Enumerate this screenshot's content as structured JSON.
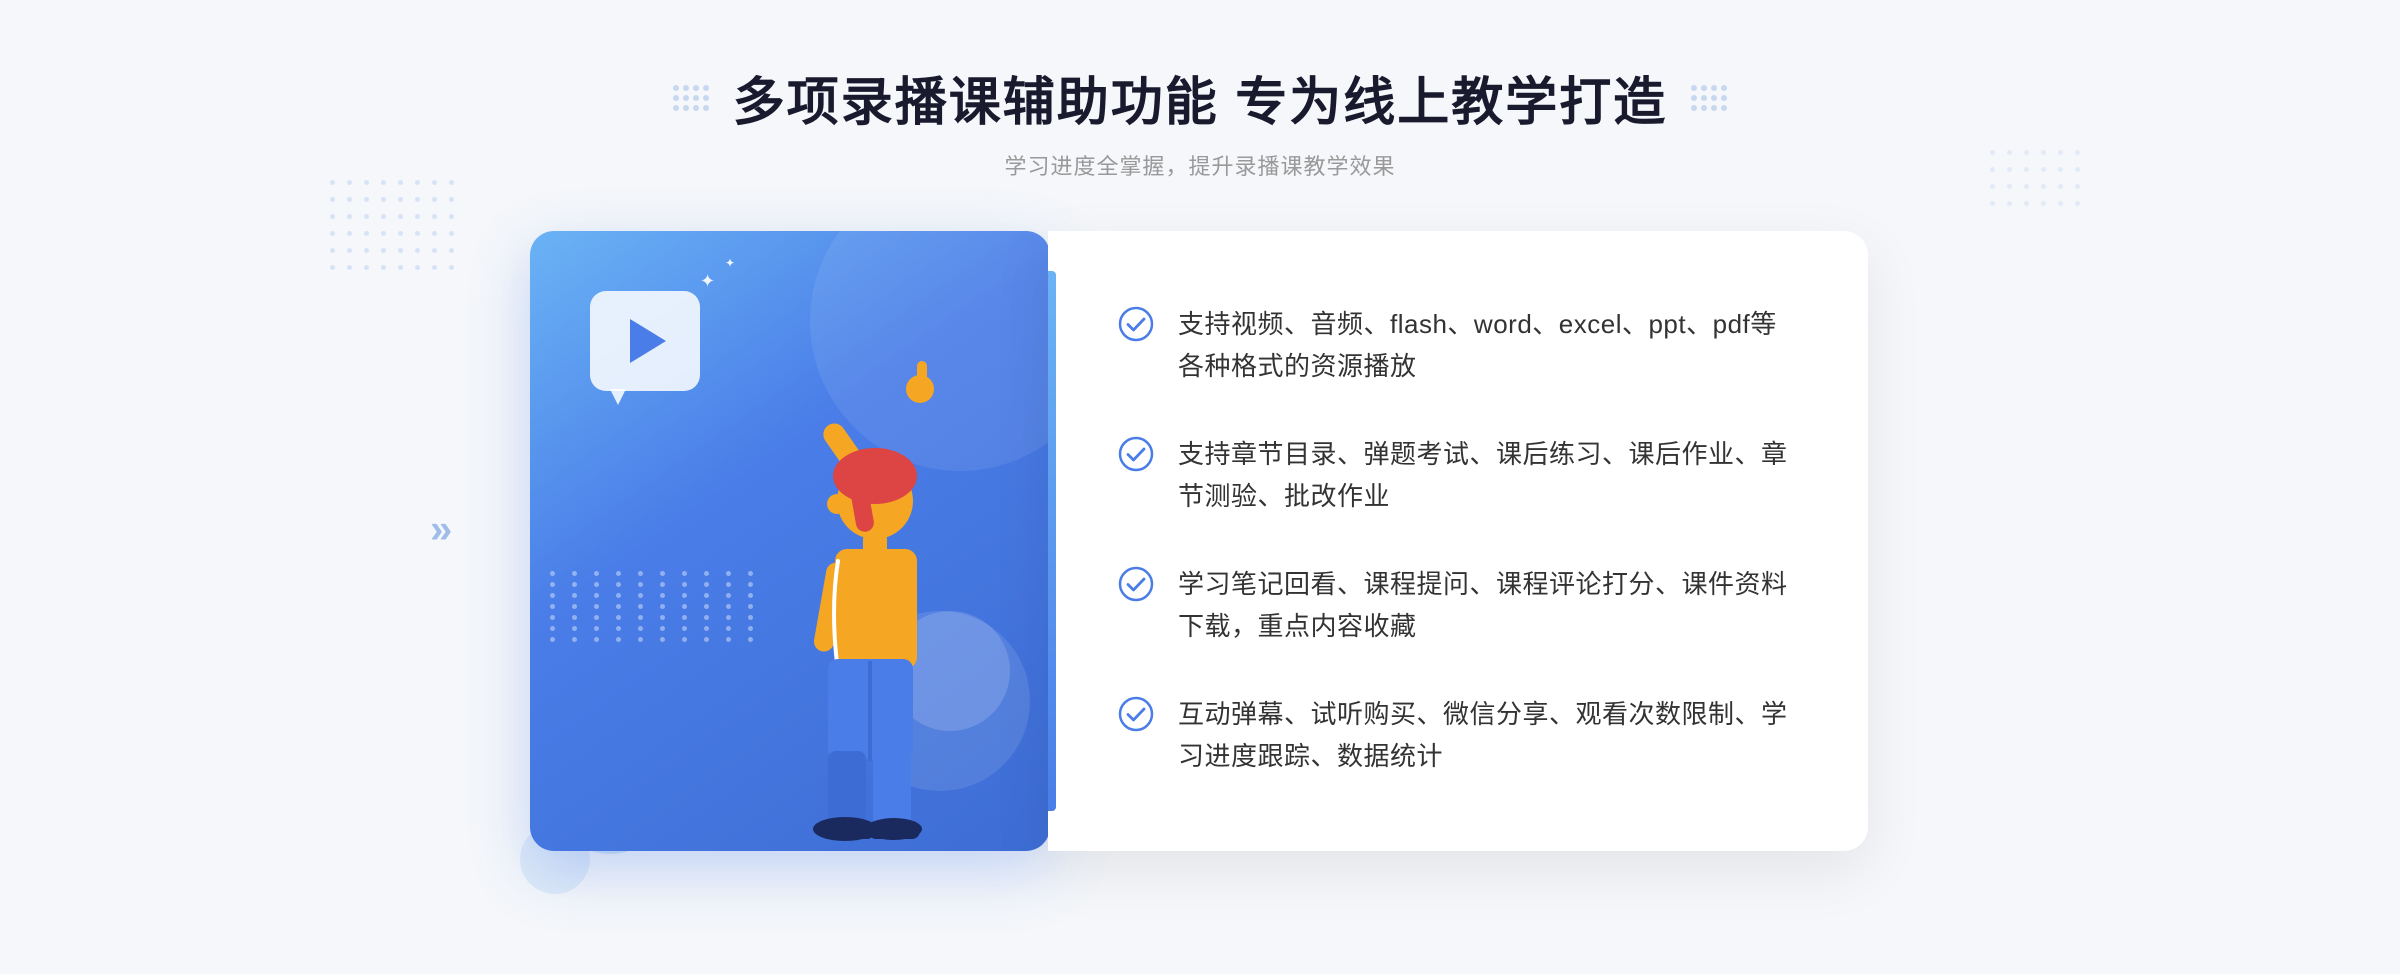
{
  "page": {
    "background_color": "#f0f4fa"
  },
  "header": {
    "title": "多项录播课辅助功能 专为线上教学打造",
    "subtitle": "学习进度全掌握，提升录播课教学效果",
    "decoration_dots": "dot-grid"
  },
  "features": [
    {
      "id": 1,
      "text": "支持视频、音频、flash、word、excel、ppt、pdf等各种格式的资源播放"
    },
    {
      "id": 2,
      "text": "支持章节目录、弹题考试、课后练习、课后作业、章节测验、批改作业"
    },
    {
      "id": 3,
      "text": "学习笔记回看、课程提问、课程评论打分、课件资料下载，重点内容收藏"
    },
    {
      "id": 4,
      "text": "互动弹幕、试听购买、微信分享、观看次数限制、学习进度跟踪、数据统计"
    }
  ],
  "illustration": {
    "play_button": "▶",
    "accent_color": "#4a7de8",
    "gradient_start": "#6ab3f5",
    "gradient_end": "#3d6dd4"
  },
  "decorations": {
    "left_chevron": "»",
    "sparkle": "✦"
  }
}
